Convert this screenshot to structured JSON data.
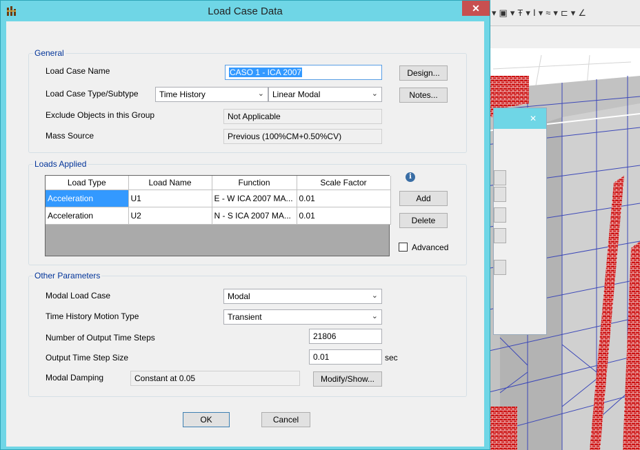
{
  "background_app": {
    "toolbar_glyphs": [
      "▾",
      "▣",
      "▾",
      "Ŧ",
      "▾",
      "Ⅰ",
      "▾",
      "≈",
      "▾",
      "⊏",
      "▾",
      "∠"
    ],
    "dialog_close": "✕"
  },
  "dialog": {
    "title": "Load Case Data",
    "close_symbol": "✕"
  },
  "general": {
    "group_label": "General",
    "load_case_name_label": "Load Case Name",
    "load_case_name_value": "CASO 1 - ICA 2007",
    "load_case_type_label": "Load Case Type/Subtype",
    "load_case_type_value": "Time History",
    "load_case_subtype_value": "Linear Modal",
    "exclude_objects_label": "Exclude Objects in this Group",
    "exclude_objects_value": "Not Applicable",
    "mass_source_label": "Mass Source",
    "mass_source_value": "Previous  (100%CM+0.50%CV)",
    "design_button": "Design...",
    "notes_button": "Notes..."
  },
  "loads_applied": {
    "group_label": "Loads Applied",
    "columns": [
      "Load Type",
      "Load Name",
      "Function",
      "Scale Factor"
    ],
    "rows": [
      {
        "load_type": "Acceleration",
        "load_name": "U1",
        "function": "E - W ICA 2007 MA...",
        "scale_factor": "0.01"
      },
      {
        "load_type": "Acceleration",
        "load_name": "U2",
        "function": "N - S  ICA 2007 MA...",
        "scale_factor": "0.01"
      }
    ],
    "info_symbol": "i",
    "add_button": "Add",
    "delete_button": "Delete",
    "advanced_label": "Advanced"
  },
  "other_parameters": {
    "group_label": "Other Parameters",
    "modal_load_case_label": "Modal Load Case",
    "modal_load_case_value": "Modal",
    "motion_type_label": "Time History Motion Type",
    "motion_type_value": "Transient",
    "output_steps_label": "Number of Output Time Steps",
    "output_steps_value": "21806",
    "step_size_label": "Output Time Step Size",
    "step_size_value": "0.01",
    "step_size_unit": "sec",
    "modal_damping_label": "Modal Damping",
    "modal_damping_value": "Constant at 0.05",
    "modify_show_button": "Modify/Show..."
  },
  "footer": {
    "ok_button": "OK",
    "cancel_button": "Cancel"
  },
  "colors": {
    "titlebar": "#6fd6e6",
    "close_button": "#c75050",
    "selection": "#3399ff",
    "group_label": "#003399"
  }
}
